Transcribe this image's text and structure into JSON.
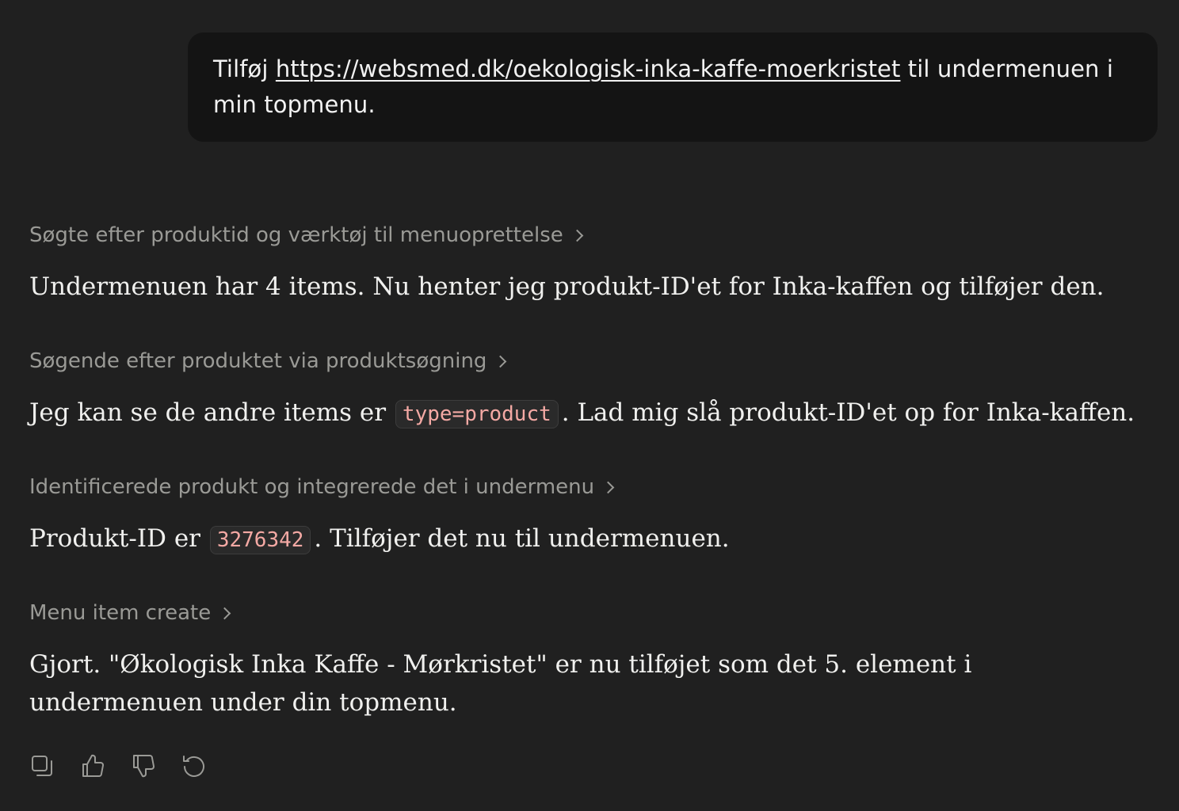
{
  "user_message": {
    "prefix": "Tilføj ",
    "link": "https://websmed.dk/oekologisk-inka-kaffe-moerkristet",
    "suffix": " til undermenuen i min topmenu."
  },
  "steps": [
    {
      "label": "Søgte efter produktid og værktøj til menuoprettelse"
    },
    {
      "label": "Søgende efter produktet via produktsøgning"
    },
    {
      "label": "Identificerede produkt og integrerede det i undermenu"
    },
    {
      "label": "Menu item create"
    }
  ],
  "responses": [
    {
      "text": "Undermenuen har 4 items. Nu henter jeg produkt-ID'et for Inka-kaffen og tilføjer den."
    },
    {
      "before": "Jeg kan se de andre items er ",
      "code": "type=product",
      "after": ". Lad mig slå produkt-ID'et op for Inka-kaffen."
    },
    {
      "before": "Produkt-ID er ",
      "code": "3276342",
      "after": ". Tilføjer det nu til undermenuen."
    },
    {
      "text": "Gjort. \"Økologisk Inka Kaffe - Mørkristet\" er nu tilføjet som det 5. element i undermenuen under din topmenu."
    }
  ],
  "actions": {
    "copy_icon": "copy-icon",
    "thumbs_up_icon": "thumbs-up-icon",
    "thumbs_down_icon": "thumbs-down-icon",
    "retry_icon": "retry-icon"
  }
}
